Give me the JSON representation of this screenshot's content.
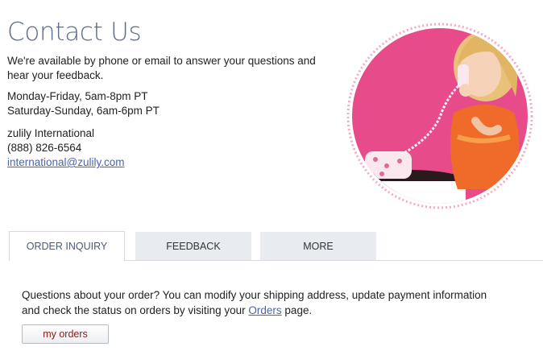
{
  "page": {
    "title": "Contact Us",
    "intro": "We're available by phone or email to answer your questions and hear your feedback.",
    "hours": [
      "Monday-Friday, 5am-8pm PT",
      "Saturday-Sunday, 6am-6pm PT"
    ],
    "international": {
      "name": "zulily International",
      "phone": "(888) 826-6564",
      "email": "international@zulily.com"
    }
  },
  "tabs": [
    {
      "label": "ORDER INQUIRY",
      "active": true
    },
    {
      "label": "FEEDBACK",
      "active": false
    },
    {
      "label": "MORE",
      "active": false
    }
  ],
  "panel": {
    "text_before": "Questions about your order? You can modify your shipping address, update payment information and check the status on orders by visiting your ",
    "link": "Orders",
    "text_after": " page.",
    "button": "my orders"
  },
  "colors": {
    "title": "#5d6b8c",
    "link": "#4a64a8",
    "hero_background": "#e84b8a",
    "hero_ring": "#f4a9c8",
    "tab_inactive": "#e8ecf0",
    "button_text": "#8b1a1a"
  }
}
